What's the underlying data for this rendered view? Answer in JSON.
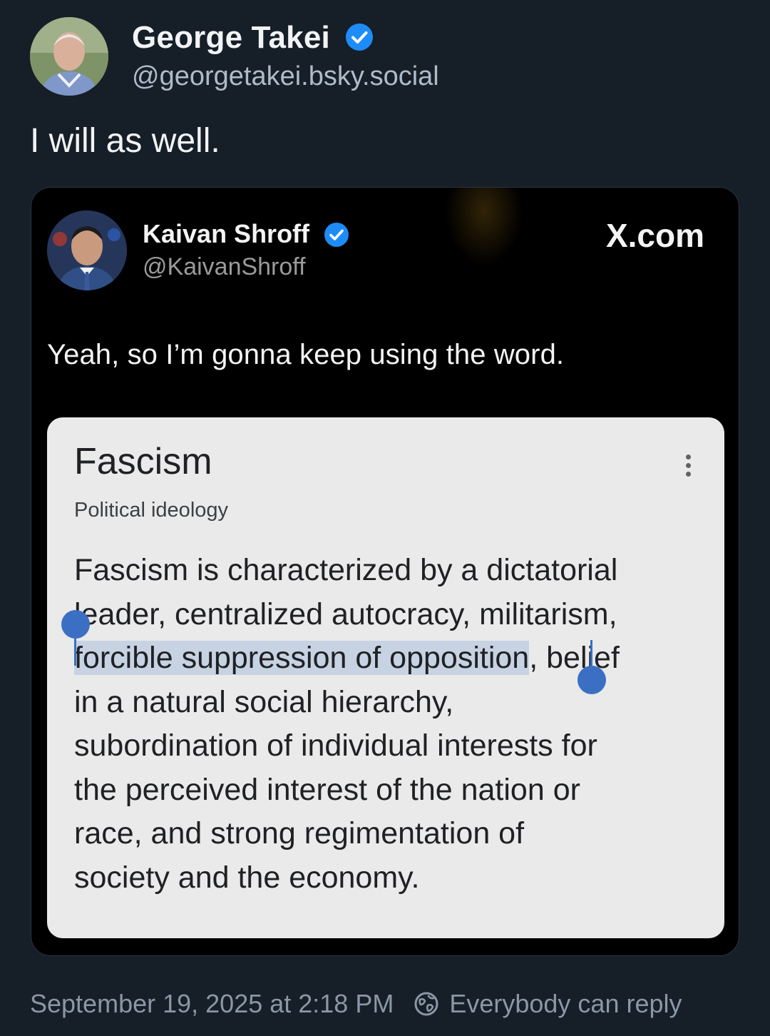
{
  "post": {
    "author": {
      "display_name": "George Takei",
      "handle": "@georgetakei.bsky.social",
      "verified": true,
      "avatar": "avatar-photo"
    },
    "text": "I will as well.",
    "timestamp": "September 19, 2025 at 2:18 PM",
    "reply_setting": "Everybody can reply",
    "reply_icon": "globe-icon"
  },
  "embed": {
    "author": {
      "display_name": "Kaivan Shroff",
      "handle": "@KaivanShroff",
      "verified": true,
      "avatar": "avatar-photo"
    },
    "source_label": "X.com",
    "text": "Yeah, so I’m gonna keep using the word.",
    "definition": {
      "title": "Fascism",
      "subtitle": "Political ideology",
      "menu_icon": "more-vertical-icon",
      "lines": [
        {
          "before": "Fascism is characterized by a dictatorial",
          "highlight": "",
          "after": ""
        },
        {
          "before": "leader, centralized autocracy, militarism,",
          "highlight": "",
          "after": ""
        },
        {
          "before": "",
          "highlight": "forcible suppression of opposition",
          "after": ", belief"
        },
        {
          "before": "in a natural social hierarchy,",
          "highlight": "",
          "after": ""
        },
        {
          "before": "subordination of individual interests for",
          "highlight": "",
          "after": ""
        },
        {
          "before": "the perceived interest of the nation or",
          "highlight": "",
          "after": ""
        },
        {
          "before": "race, and strong regimentation of",
          "highlight": "",
          "after": ""
        },
        {
          "before": "society and the economy.",
          "highlight": "",
          "after": ""
        }
      ]
    }
  },
  "colors": {
    "background": "#161e27",
    "verified_badge": "#1d8cf8",
    "selection": "#c7d3e3",
    "selection_handle": "#3a6fc4"
  }
}
